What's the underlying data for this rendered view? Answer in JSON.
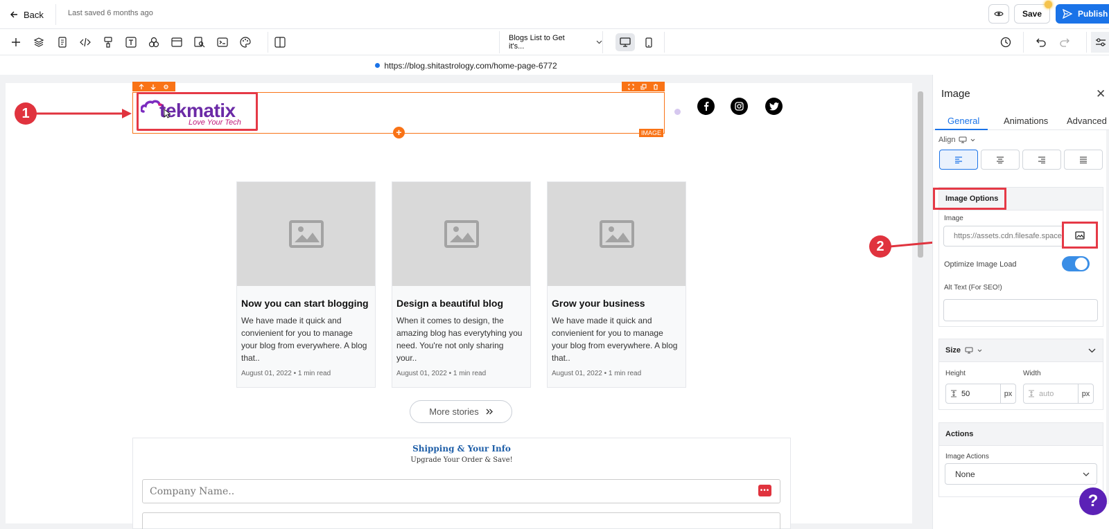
{
  "topbar": {
    "back_label": "Back",
    "saved_status": "Last saved 6 months ago",
    "save_label": "Save",
    "publish_label": "Publish"
  },
  "toolbar": {
    "icons": [
      "plus-icon",
      "layers-icon",
      "page-icon",
      "code-icon",
      "paint-icon",
      "text-icon",
      "shapes-icon",
      "section-icon",
      "search-page-icon",
      "terminal-icon",
      "palette-icon",
      "columns-icon"
    ],
    "page_selector": "Blogs List to Get it's...",
    "device": "desktop"
  },
  "url": "https://blog.shitastrology.com/home-page-6772",
  "canvas": {
    "selected_element_label": "IMAGE",
    "logo": {
      "name": "tekmatix",
      "tagline": "Love Your Tech"
    },
    "social": [
      "facebook",
      "instagram",
      "twitter"
    ],
    "cards": [
      {
        "title": "Now you can start blogging",
        "desc": "We have made it quick and convienient for you to manage your blog from everywhere. A blog that..",
        "date": "August 01, 2022",
        "read": "1 min read"
      },
      {
        "title": "Design a beautiful blog",
        "desc": "When it comes to design, the amazing blog has everytyhing you need. You're not only sharing your..",
        "date": "August 01, 2022",
        "read": "1 min read"
      },
      {
        "title": "Grow your business",
        "desc": "We have made it quick and convienient for you to manage your blog from everywhere. A blog that..",
        "date": "August 01, 2022",
        "read": "1 min read"
      }
    ],
    "more_label": "More stories",
    "form": {
      "title": "Shipping & Your Info",
      "subtitle": "Upgrade Your Order & Save!",
      "company_placeholder": "Company Name.."
    }
  },
  "annotations": {
    "one": "1",
    "two": "2"
  },
  "panel": {
    "title": "Image",
    "tabs": [
      "General",
      "Animations",
      "Advanced"
    ],
    "active_tab": "General",
    "align_label": "Align",
    "image_options_title": "Image Options",
    "image_label": "Image",
    "image_url": "https://assets.cdn.filesafe.space/",
    "optimize_label": "Optimize Image Load",
    "optimize_on": true,
    "alt_label": "Alt Text (For SEO!)",
    "size_title": "Size",
    "height_label": "Height",
    "height_value": "50",
    "height_unit": "px",
    "width_label": "Width",
    "width_placeholder": "auto",
    "width_unit": "px",
    "actions_title": "Actions",
    "image_actions_label": "Image Actions",
    "image_actions_value": "None"
  },
  "colors": {
    "accent": "#1a73e8",
    "selection": "#f97316",
    "annotation": "#e53946",
    "help": "#5b21b6"
  }
}
